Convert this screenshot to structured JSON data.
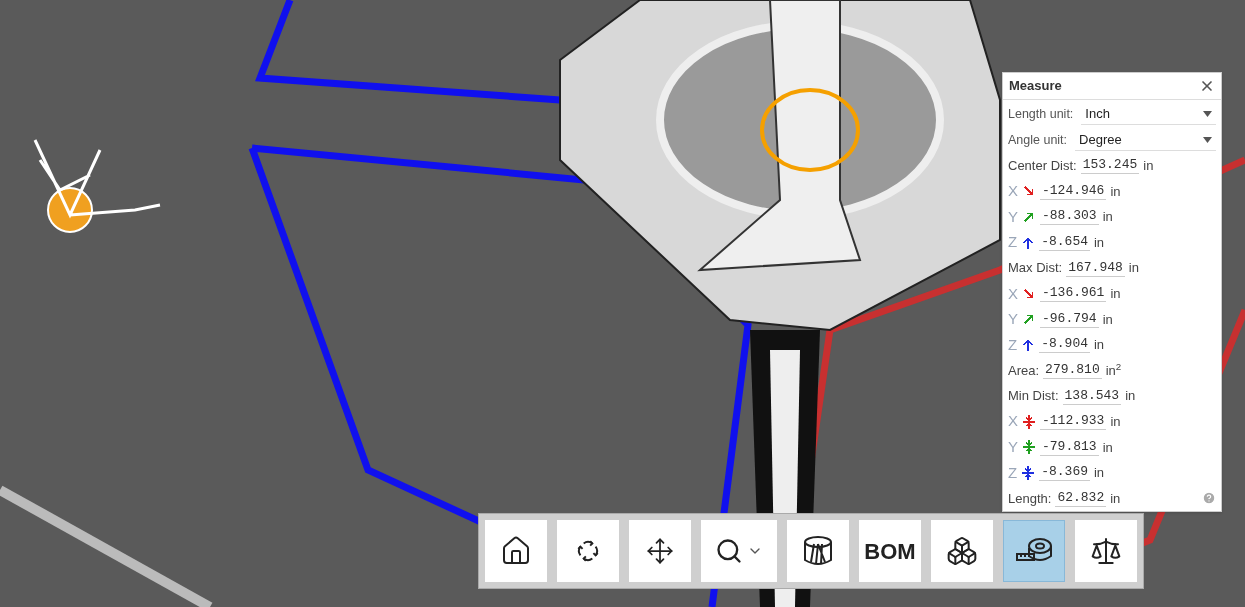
{
  "measure": {
    "title": "Measure",
    "units": [
      {
        "label": "Length unit:",
        "value": "Inch"
      },
      {
        "label": "Angle unit:",
        "value": "Degree"
      }
    ],
    "rows": [
      {
        "kind": "dist",
        "label": "Center Dist:",
        "value": "153.245",
        "unit": "in"
      },
      {
        "kind": "dx",
        "axis": "X",
        "color": "#e02020",
        "value": "-124.946",
        "unit": "in"
      },
      {
        "kind": "dy",
        "axis": "Y",
        "color": "#20a020",
        "value": "-88.303",
        "unit": "in"
      },
      {
        "kind": "dz",
        "axis": "Z",
        "color": "#2030e0",
        "value": "-8.654",
        "unit": "in"
      },
      {
        "kind": "dist",
        "label": "Max Dist:",
        "value": "167.948",
        "unit": "in"
      },
      {
        "kind": "dx",
        "axis": "X",
        "color": "#e02020",
        "value": "-136.961",
        "unit": "in"
      },
      {
        "kind": "dy",
        "axis": "Y",
        "color": "#20a020",
        "value": "-96.794",
        "unit": "in"
      },
      {
        "kind": "dz",
        "axis": "Z",
        "color": "#2030e0",
        "value": "-8.904",
        "unit": "in"
      },
      {
        "kind": "dist",
        "label": "Area:",
        "value": "279.810",
        "unit": "in$^{2}$"
      },
      {
        "kind": "dist",
        "label": "Min Dist:",
        "value": "138.543",
        "unit": "in"
      },
      {
        "kind": "gap",
        "axis": "X",
        "color": "#e02020",
        "value": "-112.933",
        "unit": "in"
      },
      {
        "kind": "gap",
        "axis": "Y",
        "color": "#20a020",
        "value": "-79.813",
        "unit": "in"
      },
      {
        "kind": "gap",
        "axis": "Z",
        "color": "#2030e0",
        "value": "-8.369",
        "unit": "in"
      },
      {
        "kind": "dist",
        "label": "Length:",
        "value": "62.832",
        "unit": "in"
      }
    ]
  },
  "toolbar": [
    {
      "kind": "home",
      "selected": false
    },
    {
      "kind": "rotate",
      "selected": false
    },
    {
      "kind": "pan",
      "selected": false
    },
    {
      "kind": "zoom",
      "selected": false
    },
    {
      "kind": "section",
      "selected": false
    },
    {
      "kind": "text",
      "label": "BOM",
      "selected": false
    },
    {
      "kind": "explode",
      "selected": false
    },
    {
      "kind": "measure",
      "selected": true
    },
    {
      "kind": "mass",
      "selected": false
    }
  ]
}
